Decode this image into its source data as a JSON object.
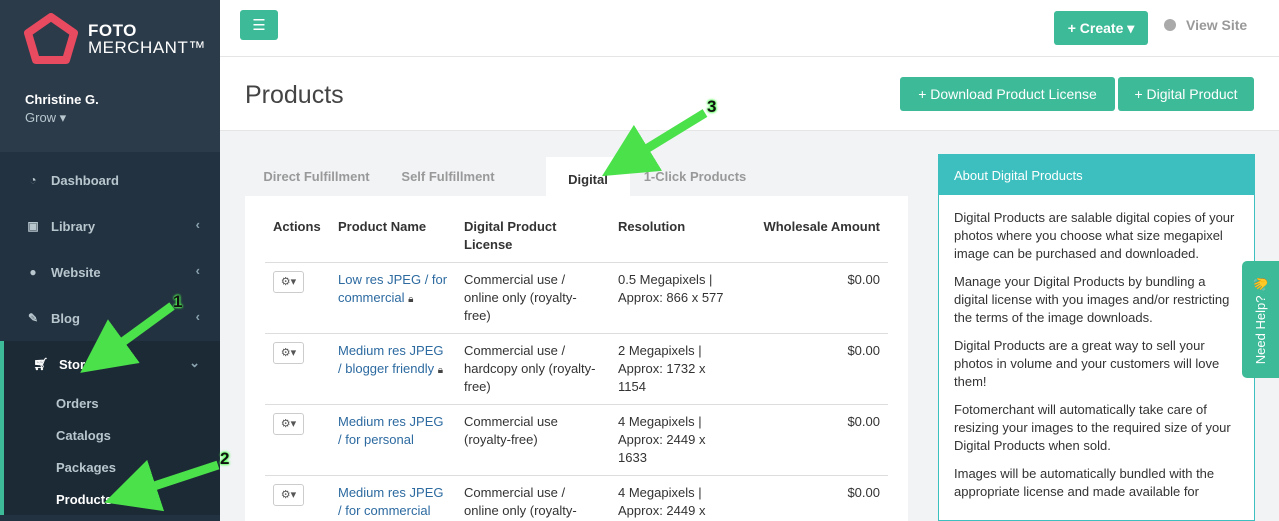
{
  "brand": {
    "line1": "FOTO",
    "line2": "MERCHANT™"
  },
  "user": {
    "name": "Christine G.",
    "plan": "Grow ▾"
  },
  "nav": {
    "items": [
      {
        "label": "Dashboard",
        "icon": "dashboard-icon"
      },
      {
        "label": "Library",
        "icon": "image-icon"
      },
      {
        "label": "Website",
        "icon": "globe-icon"
      },
      {
        "label": "Blog",
        "icon": "edit-icon"
      },
      {
        "label": "Store",
        "icon": "cart-icon"
      }
    ],
    "store_sub": [
      "Orders",
      "Catalogs",
      "Packages",
      "Products"
    ]
  },
  "topbar": {
    "create_label": "+ Create ▾",
    "view_site_label": "View Site"
  },
  "header": {
    "title": "Products",
    "download_license_label": "+ Download Product License",
    "digital_product_label": "+ Digital Product"
  },
  "tabs": [
    "Direct Fulfillment",
    "Self Fulfillment",
    "Digital",
    "1-Click Products"
  ],
  "table": {
    "headers": {
      "actions": "Actions",
      "name": "Product Name",
      "license": "Digital Product License",
      "resolution": "Resolution",
      "wholesale": "Wholesale Amount"
    },
    "rows": [
      {
        "name": "Low res JPEG / for commercial",
        "license": "Commercial use / online only (royalty-free)",
        "resolution": "0.5 Megapixels | Approx: 866 x 577",
        "amount": "$0.00",
        "locked": true
      },
      {
        "name": "Medium res JPEG / blogger friendly",
        "license": "Commercial use / hardcopy only (royalty-free)",
        "resolution": "2 Megapixels | Approx: 1732 x 1154",
        "amount": "$0.00",
        "locked": true
      },
      {
        "name": "Medium res JPEG / for personal",
        "license": "Commercial use (royalty-free)",
        "resolution": "4 Megapixels | Approx: 2449 x 1633",
        "amount": "$0.00",
        "locked": false
      },
      {
        "name": "Medium res JPEG / for commercial",
        "license": "Commercial use / online only (royalty-",
        "resolution": "4 Megapixels | Approx: 2449 x",
        "amount": "$0.00",
        "locked": false
      }
    ]
  },
  "panel": {
    "title": "About Digital Products",
    "paragraphs": [
      "Digital Products are salable digital copies of your photos where you choose what size megapixel image can be purchased and downloaded.",
      "Manage your Digital Products by bundling a digital license with you images and/or restricting the terms of the image downloads.",
      "Digital Products are a great way to sell your photos in volume and your customers will love them!",
      "Fotomerchant will automatically take care of resizing your images to the required size of your Digital Products when sold.",
      "Images will be automatically bundled with the appropriate license and made available for"
    ]
  },
  "need_help": "Need Help? 👋",
  "annotations": [
    "1",
    "2",
    "3"
  ],
  "colors": {
    "accent": "#3dba98",
    "sidebar": "#2c3b4a",
    "panel_head": "#3dbfbf",
    "arrow": "#4be14b"
  }
}
